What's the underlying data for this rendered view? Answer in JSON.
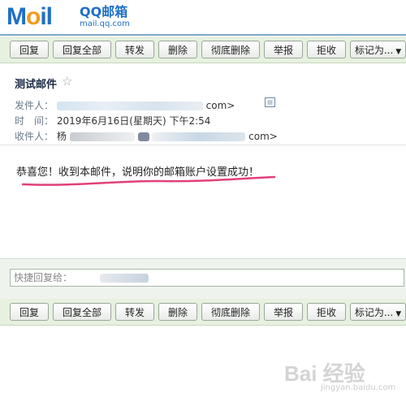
{
  "logo": {
    "main_left": "M",
    "main_mid": "o",
    "main_right": "il",
    "brand": "QQ邮箱",
    "domain": "mail.qq.com"
  },
  "toolbar": {
    "buttons": [
      "回复",
      "回复全部",
      "转发",
      "删除",
      "彻底删除",
      "举报",
      "拒收",
      "标记为..."
    ]
  },
  "email": {
    "subject": "测试邮件",
    "star_icon": "star-outline-icon",
    "sender_label": "发件人：",
    "sender_suffix": "com>",
    "time_label": "时　间：",
    "time_value": "2019年6月16日(星期天) 下午2:54",
    "recipient_label": "收件人：",
    "recipient_prefix": "杨",
    "recipient_suffix": "com>",
    "body": "恭喜您！收到本邮件，说明你的邮箱账户设置成功！"
  },
  "reply": {
    "label": "快捷回复给："
  },
  "watermark": {
    "text": "Bai 经验",
    "sub": "jingyan.baidu.com"
  },
  "colors": {
    "toolbar_bg": "#e7f1e0",
    "underline": "#e0407a",
    "logo_blue": "#1f6fc6",
    "logo_orange": "#f39a1e"
  }
}
